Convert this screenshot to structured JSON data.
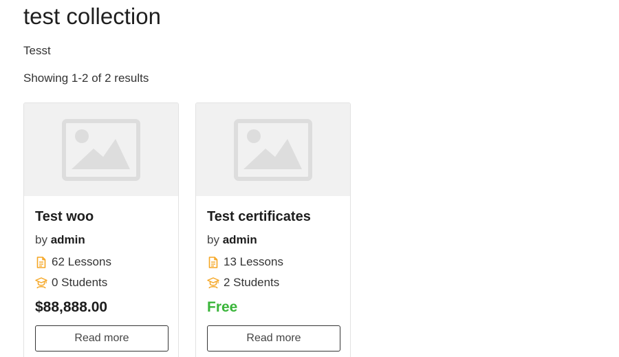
{
  "page": {
    "title": "test collection",
    "description": "Tesst",
    "results_text": "Showing 1-2 of 2 results"
  },
  "courses": [
    {
      "title": "Test woo",
      "by_label": "by",
      "author": "admin",
      "lessons": "62 Lessons",
      "students": "0 Students",
      "price": "$88,888.00",
      "button_label": "Read more"
    },
    {
      "title": "Test certificates",
      "by_label": "by",
      "author": "admin",
      "lessons": "13 Lessons",
      "students": "2 Students",
      "price": "Free",
      "button_label": "Read more"
    }
  ],
  "icons": {
    "thumbnail": "image-placeholder-icon",
    "lessons": "file-icon",
    "students": "student-icon"
  },
  "colors": {
    "icon_accent": "#f5a623",
    "free_price": "#3ab53a",
    "placeholder_bg": "#f1f1f1",
    "placeholder_icon": "#dddddd"
  }
}
